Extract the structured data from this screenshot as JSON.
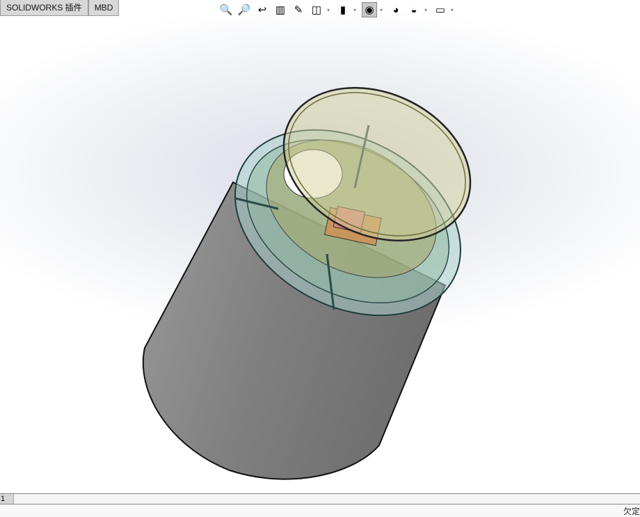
{
  "tabs": [
    {
      "label": "SOLIDWORKS 插件"
    },
    {
      "label": "MBD"
    }
  ],
  "toolbar": [
    {
      "icon": "zoom-to-fit-icon",
      "glyph": "🔍"
    },
    {
      "icon": "zoom-to-area-icon",
      "glyph": "🔎"
    },
    {
      "icon": "previous-view-icon",
      "glyph": "↩"
    },
    {
      "icon": "section-view-icon",
      "glyph": "▥"
    },
    {
      "icon": "dynamic-annotation-icon",
      "glyph": "✎"
    },
    {
      "icon": "view-orientation-icon",
      "glyph": "◫",
      "dropdown": true
    },
    {
      "icon": "display-style-icon",
      "glyph": "▮",
      "dropdown": true
    },
    {
      "icon": "hide-show-items-icon",
      "glyph": "◉",
      "dropdown": true,
      "active": true
    },
    {
      "icon": "edit-appearance-icon",
      "glyph": "◕"
    },
    {
      "icon": "apply-scene-icon",
      "glyph": "◒",
      "dropdown": true
    },
    {
      "icon": "view-settings-icon",
      "glyph": "▭",
      "dropdown": true
    }
  ],
  "sheet": {
    "label": "1"
  },
  "status": {
    "text": "欠定义"
  },
  "colors": {
    "body": "#7f7f7f",
    "ring": "#6fb3ad",
    "lid": "#c8c28a",
    "bracket": "#c9955a"
  }
}
